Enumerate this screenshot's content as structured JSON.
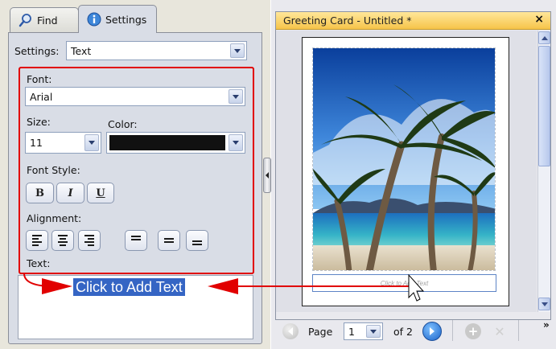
{
  "tabs": [
    {
      "label": "Find",
      "icon": "magnifier-icon"
    },
    {
      "label": "Settings",
      "icon": "info-icon"
    }
  ],
  "settings": {
    "label": "Settings:",
    "value": "Text"
  },
  "text_panel": {
    "font_label": "Font:",
    "font_value": "Arial",
    "size_label": "Size:",
    "size_value": "11",
    "color_label": "Color:",
    "color_value": "#111111",
    "font_style_label": "Font Style:",
    "bold_label": "B",
    "italic_label": "I",
    "underline_label": "U",
    "alignment_label": "Alignment:",
    "text_label": "Text:",
    "text_placeholder": "Click to Add Text"
  },
  "preview": {
    "title": "Greeting Card - Untitled *",
    "close_glyph": "×",
    "card_text_placeholder": "Click to Add Text",
    "photo": "palm-trees-beach"
  },
  "navigation": {
    "page_label": "Page",
    "current_page": "1",
    "of_label": "of 2",
    "more_glyph": "»"
  },
  "colors": {
    "highlight_border": "#e10000",
    "selection": "#3565c4",
    "titlebar": "#f6c44a"
  }
}
